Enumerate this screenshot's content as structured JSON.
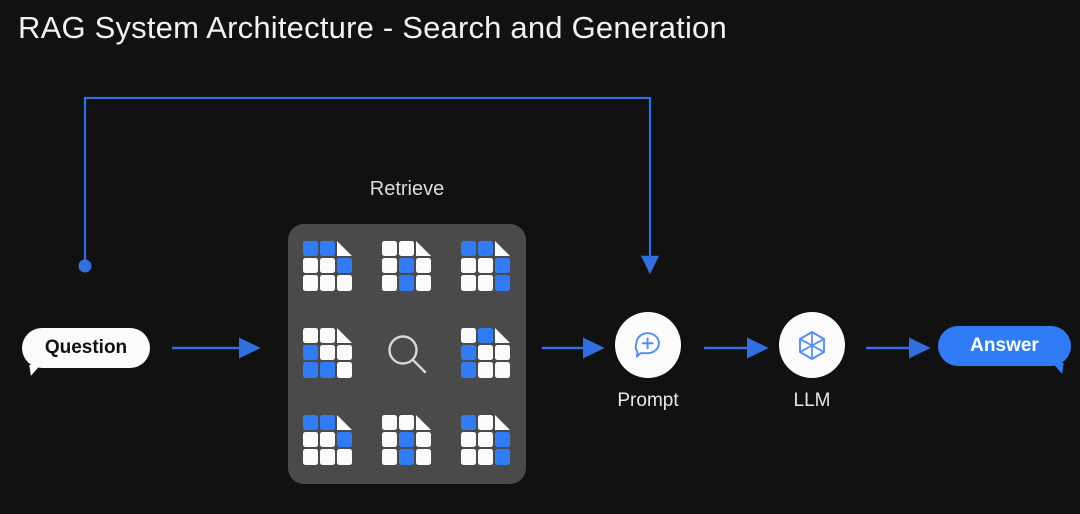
{
  "page": {
    "title": "RAG System Architecture - Search and Generation",
    "background_color": "#111111",
    "accent_color": "#2f7cf6"
  },
  "nodes": {
    "question": {
      "label": "Question",
      "bubble_color": "#fbfbfb",
      "text_color": "#111111"
    },
    "answer": {
      "label": "Answer",
      "bubble_color": "#2f7cf6",
      "text_color": "#ffffff"
    },
    "retrieve": {
      "label": "Retrieve",
      "box_color": "#4a4a4a",
      "center_icon": "magnifier-icon",
      "documents": [
        {
          "name": "document-1",
          "cells": [
            "blue",
            "blue",
            "fold",
            "white",
            "white",
            "blue",
            "white",
            "white",
            "white"
          ]
        },
        {
          "name": "document-2",
          "cells": [
            "white",
            "white",
            "fold",
            "white",
            "blue",
            "white",
            "white",
            "blue",
            "white"
          ]
        },
        {
          "name": "document-3",
          "cells": [
            "blue",
            "blue",
            "fold",
            "white",
            "white",
            "blue",
            "white",
            "white",
            "blue"
          ]
        },
        {
          "name": "document-4",
          "cells": [
            "white",
            "white",
            "fold",
            "blue",
            "white",
            "white",
            "blue",
            "blue",
            "white"
          ]
        },
        {
          "name": "document-5",
          "cells": [
            "white",
            "blue",
            "fold",
            "blue",
            "white",
            "white",
            "blue",
            "white",
            "white"
          ]
        },
        {
          "name": "document-6",
          "cells": [
            "blue",
            "blue",
            "fold",
            "white",
            "white",
            "blue",
            "white",
            "white",
            "white"
          ]
        },
        {
          "name": "document-7",
          "cells": [
            "white",
            "white",
            "fold",
            "white",
            "blue",
            "white",
            "white",
            "blue",
            "white"
          ]
        },
        {
          "name": "document-8",
          "cells": [
            "blue",
            "white",
            "fold",
            "white",
            "white",
            "blue",
            "white",
            "white",
            "blue"
          ]
        }
      ]
    },
    "prompt": {
      "label": "Prompt",
      "icon": "chat-bubble-plus-icon",
      "disc_color": "#fbfbfb",
      "icon_color": "#4f8df7"
    },
    "llm": {
      "label": "LLM",
      "icon": "cube-hexagon-icon",
      "disc_color": "#fbfbfb",
      "icon_color": "#4f8df7"
    }
  },
  "flow": {
    "arrow_color": "#2f6fe0",
    "edges": [
      {
        "name": "question-to-retrieve",
        "from": "Question",
        "to": "Retrieve"
      },
      {
        "name": "retrieve-to-prompt",
        "from": "Retrieve",
        "to": "Prompt"
      },
      {
        "name": "prompt-to-llm",
        "from": "Prompt",
        "to": "LLM"
      },
      {
        "name": "llm-to-answer",
        "from": "LLM",
        "to": "Answer"
      },
      {
        "name": "question-feedback-to-prompt",
        "from": "Question",
        "to": "Prompt"
      }
    ]
  }
}
